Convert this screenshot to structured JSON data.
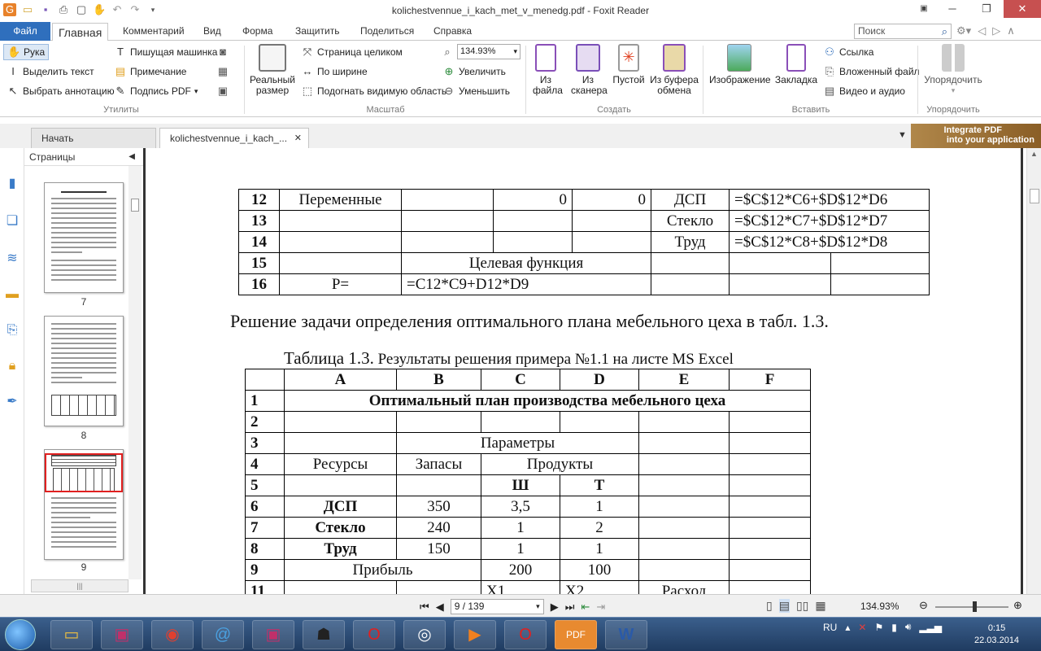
{
  "window": {
    "title": "kolichestvennue_i_kach_met_v_menedg.pdf - Foxit Reader"
  },
  "menu": {
    "file": "Файл",
    "tabs": [
      "Главная",
      "Комментарий",
      "Вид",
      "Форма",
      "Защитить",
      "Поделиться",
      "Справка"
    ],
    "search_placeholder": "Поиск"
  },
  "ribbon": {
    "utilities": {
      "hand": "Рука",
      "select_text": "Выделить текст",
      "select_annotation": "Выбрать аннотацию",
      "typewriter": "Пишущая машинка",
      "note": "Примечание",
      "sign_pdf": "Подпись PDF",
      "label": "Утилиты"
    },
    "zoom": {
      "actual_size": "Реальный размер",
      "fit_page": "Страница целиком",
      "fit_width": "По ширине",
      "fit_visible": "Подогнать видимую область",
      "value": "134.93%",
      "zoom_in": "Увеличить",
      "zoom_out": "Уменьшить",
      "label": "Масштаб"
    },
    "create": {
      "from_file": "Из файла",
      "from_scanner": "Из сканера",
      "blank": "Пустой",
      "from_clipboard": "Из буфера обмена",
      "label": "Создать"
    },
    "insert": {
      "image": "Изображение",
      "bookmark": "Закладка",
      "link": "Ссылка",
      "attached_file": "Вложенный файл",
      "video_audio": "Видео и аудио",
      "label": "Вставить"
    },
    "arrange": {
      "label": "Упорядочить",
      "group_label": "Упорядочить"
    }
  },
  "doc_tabs": {
    "start": "Начать",
    "document": "kolichestvennue_i_kach_..."
  },
  "promo": {
    "line1": "Integrate PDF",
    "line2": "into your application"
  },
  "panel": {
    "title": "Страницы",
    "pages": [
      "7",
      "8",
      "9"
    ]
  },
  "document": {
    "top_table": [
      [
        "12",
        "Переменные",
        "",
        "0",
        "0",
        "ДСП",
        "=$C$12*C6+$D$12*D6"
      ],
      [
        "13",
        "",
        "",
        "",
        "",
        "Стекло",
        "=$C$12*C7+$D$12*D7"
      ],
      [
        "14",
        "",
        "",
        "",
        "",
        "Труд",
        "=$C$12*C8+$D$12*D8"
      ],
      [
        "15",
        "",
        "Целевая функция",
        "",
        ""
      ],
      [
        "16",
        "P=",
        "=C12*C9+D12*D9",
        "",
        ""
      ]
    ],
    "paragraph": "Решение задачи определения оптимального плана мебельного цеха в табл. 1.3.",
    "caption_prefix": "Таблица 1.3.",
    "caption_rest": " Результаты решения примера №1.1 на листе MS Excel",
    "table": {
      "headers": [
        "",
        "A",
        "B",
        "C",
        "D",
        "E",
        "F"
      ],
      "title": "Оптимальный план производства мебельного цеха",
      "params": "Параметры",
      "resources": "Ресурсы",
      "stocks": "Запасы",
      "products": "Продукты",
      "sh": "Ш",
      "t": "Т",
      "rows": [
        {
          "n": "6",
          "name": "ДСП",
          "stock": "350",
          "c": "3,5",
          "d": "1"
        },
        {
          "n": "7",
          "name": "Стекло",
          "stock": "240",
          "c": "1",
          "d": "2"
        },
        {
          "n": "8",
          "name": "Труд",
          "stock": "150",
          "c": "1",
          "d": "1"
        }
      ],
      "profit": "Прибыль",
      "profit_c": "200",
      "profit_d": "100",
      "row11": {
        "n": "11",
        "c": "X1",
        "d": "X2",
        "e": "Расход"
      },
      "row_nums": [
        "1",
        "2",
        "3",
        "4",
        "5",
        "9"
      ]
    }
  },
  "status": {
    "page": "9 / 139",
    "zoom": "134.93%"
  },
  "taskbar": {
    "lang": "RU",
    "time": "0:15",
    "date": "22.03.2014"
  }
}
